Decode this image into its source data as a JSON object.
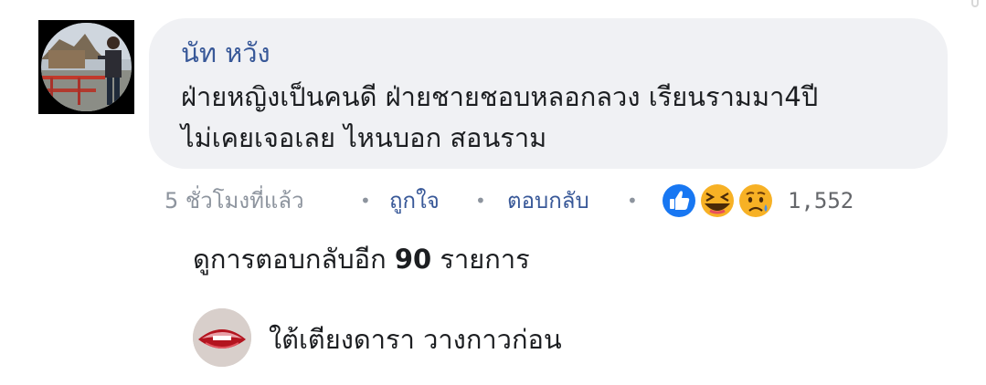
{
  "comment": {
    "author": "นัท หวัง",
    "lines": [
      "ฝ่ายหญิงเป็นคนดี ฝ่ายชายชอบหลอกลวง เรียนรามมา4ปี",
      "ไม่เคยเจอเลย ไหนบอก สอนราม"
    ],
    "time": "5 ชั่วโมงที่แล้ว",
    "separator": "•",
    "like_label": "ถูกใจ",
    "reply_label": "ตอบกลับ",
    "reactions": [
      "like-icon",
      "laugh-icon",
      "sad-icon"
    ],
    "reaction_count": "1,552"
  },
  "more_replies": {
    "prefix": "ดูการตอบกลับอีก",
    "count": "90",
    "suffix": "รายการ"
  },
  "reply": {
    "author": "ใต้เตียงดารา",
    "text": "วางกาวก่อน"
  },
  "colors": {
    "link": "#385898",
    "meta": "#8d949e",
    "bubble": "#f0f1f4",
    "like_blue": "#1877f2",
    "emoji_yellow": "#f7b125"
  }
}
